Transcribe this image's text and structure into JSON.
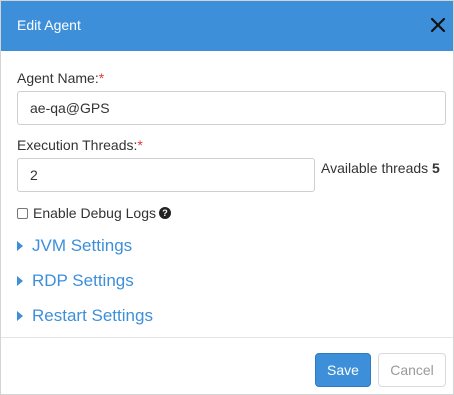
{
  "dialog": {
    "title": "Edit Agent"
  },
  "form": {
    "agent_name_label": "Agent Name:",
    "agent_name_value": "ae-qa@GPS",
    "threads_label": "Execution Threads:",
    "threads_value": "2",
    "required_marker": "*",
    "available_label": "Available threads",
    "available_value": "5",
    "debug_label": "Enable Debug Logs",
    "debug_checked": false,
    "help_glyph": "?"
  },
  "sections": [
    {
      "label": "JVM Settings"
    },
    {
      "label": "RDP Settings"
    },
    {
      "label": "Restart Settings"
    }
  ],
  "footer": {
    "save_label": "Save",
    "cancel_label": "Cancel"
  },
  "icons": {
    "close": "close-icon",
    "help": "help-icon",
    "caret": "caret-right-icon"
  },
  "colors": {
    "header": "#3d8fda",
    "accent": "#3d8fda",
    "required": "#e53935"
  }
}
